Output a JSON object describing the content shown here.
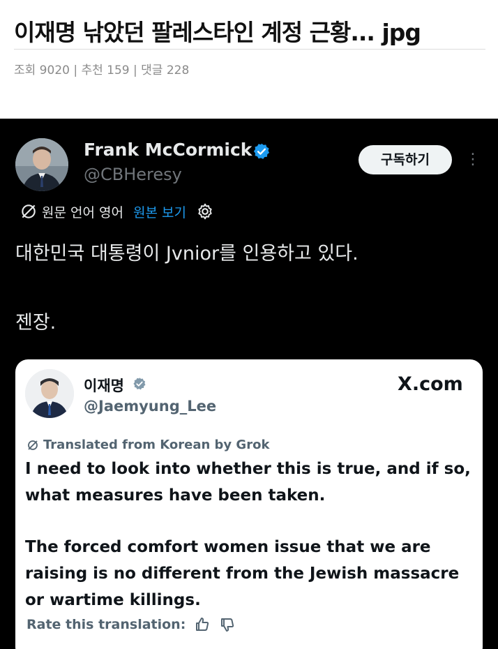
{
  "post": {
    "title": "이재명 낚았던 팔레스타인 계정 근황... jpg",
    "meta": "조회 9020 | 추천 159 | 댓글 228"
  },
  "tweet": {
    "display_name": "Frank McCormick",
    "handle": "@CBHeresy",
    "subscribe_label": "구독하기",
    "translate_lang": "원문 언어 영어",
    "show_original": "원본 보기",
    "text_line1": "대한민국 대통령이 Jvnior를 인용하고 있다.",
    "text_line2": "젠장."
  },
  "quote": {
    "name": "이재명",
    "handle": "@Jaemyung_Lee",
    "domain": "X.com",
    "translated_label": "Translated from Korean by Grok",
    "body_lines": [
      "I need to look into whether this is true, and if so,",
      "what measures have been taken.",
      "",
      "The forced comfort women issue that we are",
      "raising is no different from the Jewish massacre",
      "or wartime killings."
    ],
    "rate_label": "Rate this translation:"
  },
  "colors": {
    "tweet_bg": "#000000",
    "accent_blue": "#1d9bf0",
    "text_light": "#e7e9ea",
    "text_muted": "#71767b"
  },
  "icons": [
    "verified-badge-icon",
    "translate-icon",
    "gear-icon",
    "more-dots-icon",
    "thumbs-up-icon",
    "thumbs-down-icon"
  ]
}
